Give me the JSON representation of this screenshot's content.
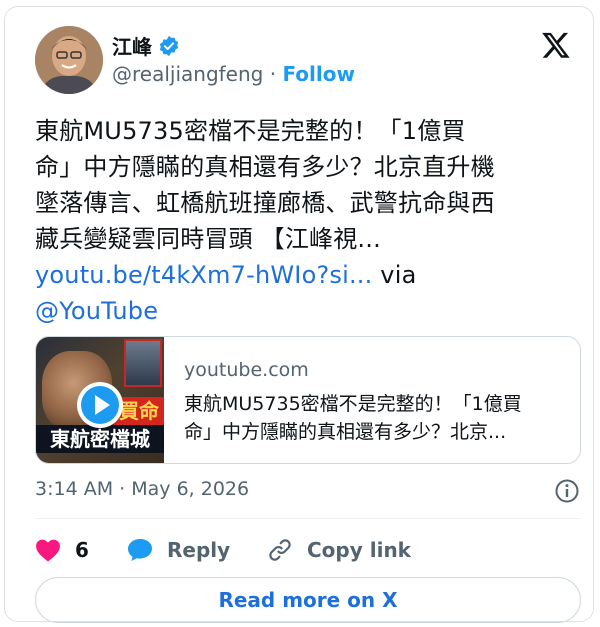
{
  "author": {
    "name": "江峰",
    "handle": "@realjiangfeng",
    "separator": "·",
    "follow_label": "Follow",
    "verified": true
  },
  "tweet": {
    "lines": [
      "東航MU5735密檔不是完整的！「1億買",
      "命」中方隱瞞的真相還有多少？北京直升機",
      "墜落傳言、虹橋航班撞廊橋、武警抗命與西",
      "藏兵變疑雲同時冒頭 【江峰視..."
    ],
    "link_text": "youtu.be/t4kXm7-hWIo?si...",
    "via_text": " via",
    "mention": "@YouTube"
  },
  "link_card": {
    "domain": "youtube.com",
    "title_lines": [
      "東航MU5735密檔不是完整的！「1億買",
      "命」中方隱瞞的真相還有多少？北京..."
    ],
    "thumbnail_caption_1": "買命",
    "thumbnail_caption_2": "東航密檔城"
  },
  "meta": {
    "time": "3:14 AM",
    "dot": "·",
    "date": "May 6, 2026"
  },
  "actions": {
    "like_count": "6",
    "reply_label": "Reply",
    "copy_label": "Copy link"
  },
  "read_more_label": "Read more on X",
  "colors": {
    "accent": "#1d9bf0",
    "link": "#1d6fdc",
    "like": "#f91880",
    "muted": "#536471"
  },
  "icons": [
    "verified-badge-icon",
    "x-logo-icon",
    "play-icon",
    "info-icon",
    "heart-icon",
    "reply-icon",
    "link-icon"
  ]
}
